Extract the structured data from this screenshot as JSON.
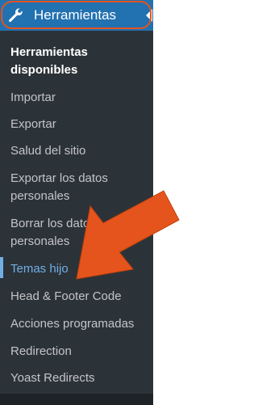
{
  "menu": {
    "title": "Herramientas",
    "icon": "wrench-icon",
    "items": [
      "Herramientas disponibles",
      "Importar",
      "Exportar",
      "Salud del sitio",
      "Exportar los datos personales",
      "Borrar los datos personales",
      "Temas hijo",
      "Head & Footer Code",
      "Acciones programadas",
      "Redirection",
      "Yoast Redirects"
    ],
    "active_item": "Temas hijo"
  },
  "colors": {
    "sidebar": "#1d2327",
    "submenu": "#2c3338",
    "accent": "#2271b1",
    "active_text": "#72aee6",
    "annotation": "#e5541d"
  }
}
